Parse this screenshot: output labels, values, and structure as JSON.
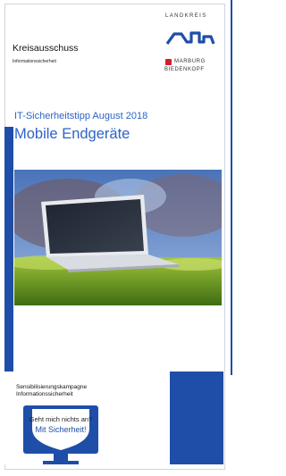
{
  "header": {
    "title": "Kreisausschuss",
    "subtitle": "Informationssicherheit"
  },
  "logo": {
    "line1": "LANDKREIS",
    "line2": "MARBURG",
    "line3": "BIEDENKOPF"
  },
  "tipp": {
    "title": "IT-Sicherheitstipp August 2018",
    "subtitle": "Mobile Endgeräte"
  },
  "campaign": {
    "line1": "Sensibilisierungskampagne",
    "line2": "Informationssicherheit"
  },
  "badge": {
    "line1": "Geht mich nichts an?",
    "line2": "Mit Sicherheit!"
  },
  "colors": {
    "primary_blue": "#1f4ea8",
    "accent_red": "#d21f2b"
  }
}
